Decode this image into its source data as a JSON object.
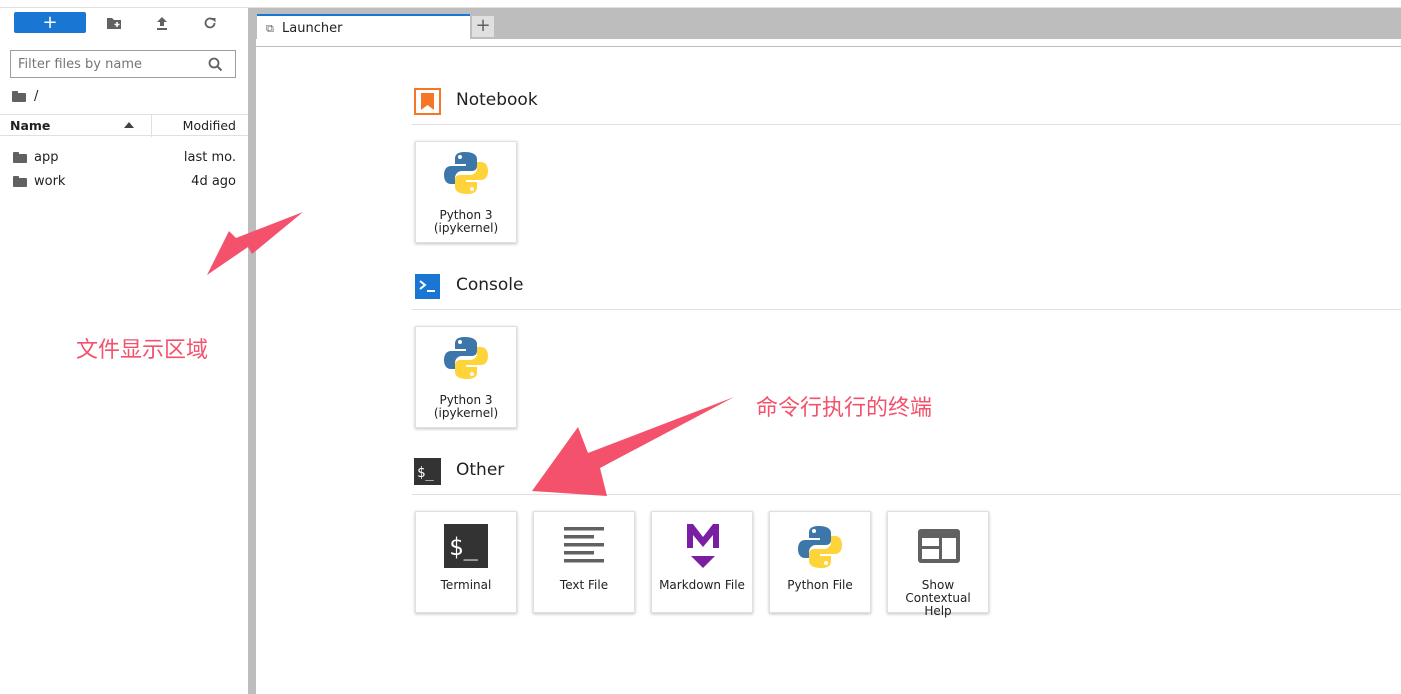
{
  "sidebar": {
    "new_button_label": "+",
    "filter_placeholder": "Filter files by name",
    "breadcrumb": "/",
    "columns": {
      "name": "Name",
      "modified": "Modified"
    },
    "files": [
      {
        "name": "app",
        "modified": "last mo."
      },
      {
        "name": "work",
        "modified": "4d ago"
      }
    ]
  },
  "annotations": {
    "file_area": "文件显示区域",
    "terminal_note": "命令行执行的终端"
  },
  "tabs": [
    {
      "label": "Launcher"
    }
  ],
  "add_tab_label": "+",
  "launcher": {
    "sections": [
      {
        "title": "Notebook",
        "cards": [
          {
            "line1": "Python 3",
            "line2": "(ipykernel)"
          }
        ]
      },
      {
        "title": "Console",
        "cards": [
          {
            "line1": "Python 3",
            "line2": "(ipykernel)"
          }
        ]
      },
      {
        "title": "Other",
        "cards": [
          {
            "line1": "Terminal"
          },
          {
            "line1": "Text File"
          },
          {
            "line1": "Markdown File"
          },
          {
            "line1": "Python File"
          },
          {
            "line1": "Show",
            "line2": "Contextual",
            "line3": "Help"
          }
        ]
      }
    ]
  },
  "colors": {
    "accent": "#1976d2",
    "annotation": "#f4516c",
    "notebook_icon": "#f37726",
    "console_icon": "#1976d2"
  }
}
